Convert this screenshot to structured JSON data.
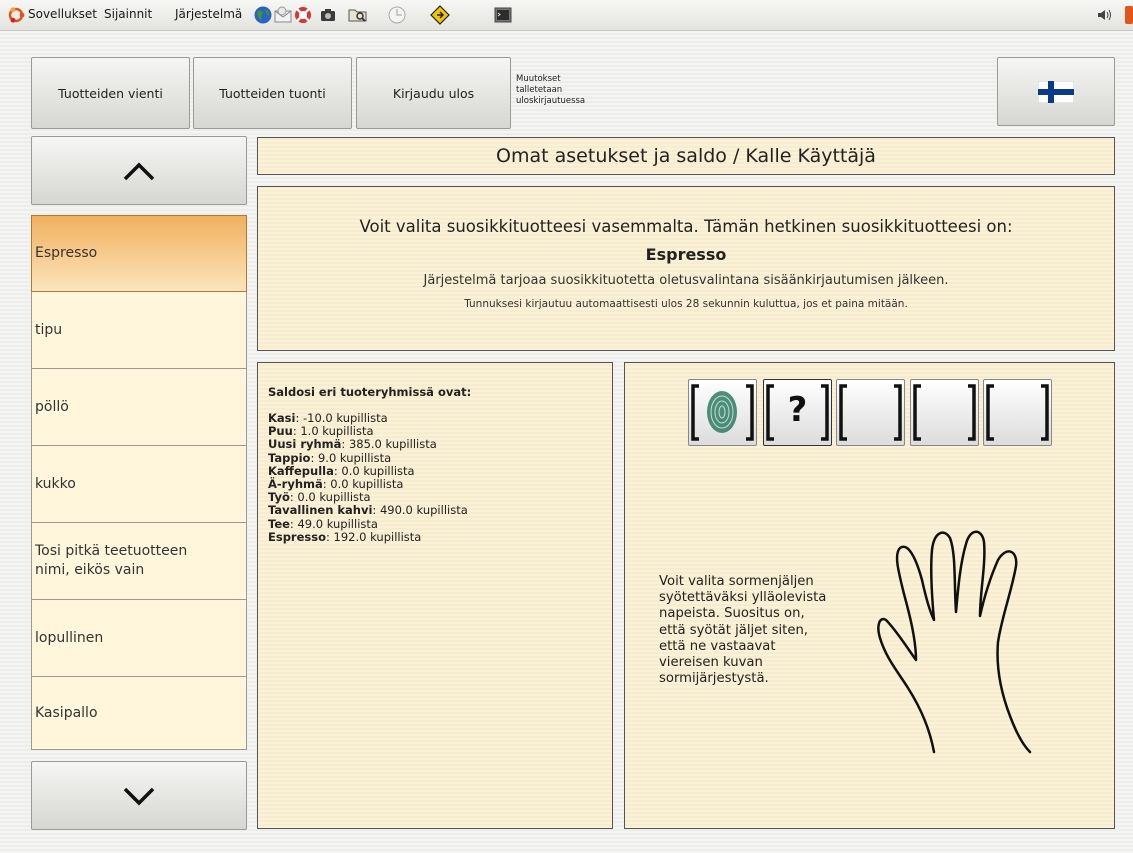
{
  "system_panel": {
    "menus": [
      "Sovellukset",
      "Sijainnit",
      "Järjestelmä"
    ],
    "icons": [
      "ubuntu-logo-icon",
      "globe-icon",
      "mail-icon",
      "help-lifebuoy-icon",
      "camera-icon",
      "folder-search-icon",
      "chat-icon",
      "pin-icon",
      "terminal-icon",
      "volume-icon"
    ]
  },
  "toolbar": {
    "export_label": "Tuotteiden vienti",
    "import_label": "Tuotteiden tuonti",
    "logout_label": "Kirjaudu ulos",
    "note_line1": "Muutokset",
    "note_line2": "talletetaan",
    "note_line3": "uloskirjautuessa",
    "language_flag": "finnish-flag-icon"
  },
  "header": {
    "title": "Omat asetukset ja saldo / Kalle Käyttäjä"
  },
  "info": {
    "intro": "Voit valita suosikkituotteesi vasemmalta. Tämän hetkinen suosikkituotteesi on:",
    "favorite": "Espresso",
    "default_note": "Järjestelmä tarjoaa suosikkituotetta oletusvalintana sisäänkirjautumisen jälkeen.",
    "logout_note": "Tunnuksesi kirjautuu automaattisesti ulos 28 sekunnin kuluttua, jos et paina mitään."
  },
  "sidebar": {
    "items": [
      {
        "label": "Espresso",
        "selected": true
      },
      {
        "label": "tipu"
      },
      {
        "label": "pöllö"
      },
      {
        "label": "kukko"
      },
      {
        "label": "Tosi pitkä teetuotteen nimi, eikös vain"
      },
      {
        "label": "lopullinen"
      },
      {
        "label": "Kasipallo"
      }
    ]
  },
  "balances": {
    "heading": "Saldosi eri tuoteryhmissä ovat:",
    "rows": [
      {
        "group": "Kasi",
        "value": ": -10.0 kupillista"
      },
      {
        "group": "Puu",
        "value": ": 1.0 kupillista"
      },
      {
        "group": "Uusi ryhmä",
        "value": ": 385.0 kupillista"
      },
      {
        "group": "Tappio",
        "value": ": 9.0 kupillista"
      },
      {
        "group": "Kaffepulla",
        "value": ": 0.0 kupillista"
      },
      {
        "group": "Ä-ryhmä",
        "value": ": 0.0 kupillista"
      },
      {
        "group": "Työ",
        "value": ": 0.0 kupillista"
      },
      {
        "group": "Tavallinen kahvi",
        "value": ": 490.0 kupillista"
      },
      {
        "group": "Tee",
        "value": ": 49.0 kupillista"
      },
      {
        "group": "Espresso",
        "value": ": 192.0 kupillista"
      }
    ]
  },
  "fingerprints": {
    "slots": [
      {
        "state": "recorded",
        "icon": "fingerprint-icon"
      },
      {
        "state": "current",
        "mark": "?"
      },
      {
        "state": "empty"
      },
      {
        "state": "empty"
      },
      {
        "state": "empty"
      }
    ],
    "instructions_1": "Voit valita sormenjäljen",
    "instructions_2": "syötettäväksi ylläolevista",
    "instructions_3": "napeista. Suositus on,",
    "instructions_4": "että syötät jäljet siten,",
    "instructions_5": "että ne vastaavat",
    "instructions_6": "viereisen kuvan",
    "instructions_7": "sormijärjestystä."
  }
}
